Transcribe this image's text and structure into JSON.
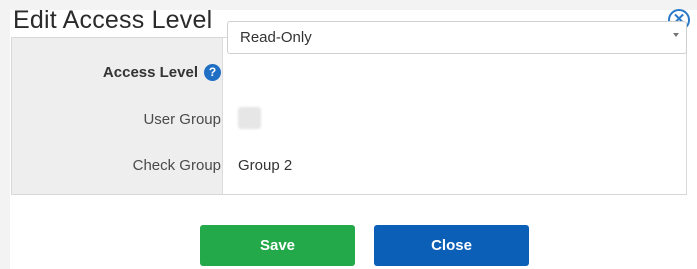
{
  "dialog": {
    "title": "Edit Access Level",
    "close_glyph": "✕"
  },
  "form": {
    "access_level": {
      "label": "Access Level",
      "help_glyph": "?",
      "selected": "Read-Only"
    },
    "user_group": {
      "label": "User Group",
      "value": ""
    },
    "check_group": {
      "label": "Check Group",
      "value": "Group 2"
    }
  },
  "buttons": {
    "save": "Save",
    "close": "Close"
  },
  "colors": {
    "accent": "#1f6fc5",
    "save": "#23a84a",
    "close": "#0b5fb7"
  }
}
